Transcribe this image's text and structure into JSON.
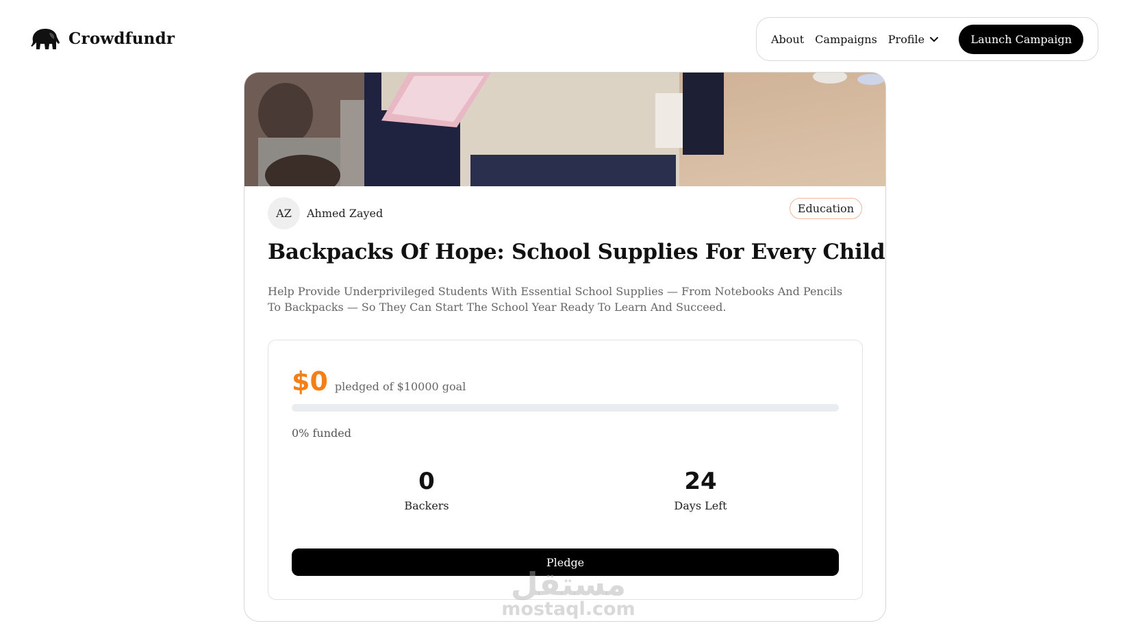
{
  "brand": {
    "name": "Crowdfundr",
    "logo_icon": "elephant-icon"
  },
  "nav": {
    "about": "About",
    "campaigns": "Campaigns",
    "profile": "Profile",
    "profile_icon": "chevron-down-icon",
    "launch": "Launch Campaign"
  },
  "campaign": {
    "creator_initials": "AZ",
    "creator_name": "Ahmed Zayed",
    "category": "Education",
    "title": "Backpacks Of Hope: School Supplies For Every Child",
    "description": "Help Provide Underprivileged Students With Essential School Supplies — From Notebooks And Pencils To Backpacks — So They Can Start The School Year Ready To Learn And Succeed.",
    "pledged_amount": "$0",
    "goal_text": "pledged of $10000 goal",
    "funded_percent": 0,
    "funded_text": "0% funded",
    "backers_count": "0",
    "backers_label": "Backers",
    "days_left": "24",
    "days_left_label": "Days Left",
    "pledge_button": "Pledge"
  },
  "colors": {
    "accent": "#f57f17",
    "button": "#000000",
    "tag_border": "#f2b49a",
    "progress_track": "#eaedf0"
  },
  "watermark": {
    "arabic": "مستقل",
    "latin": "mostaql.com"
  }
}
